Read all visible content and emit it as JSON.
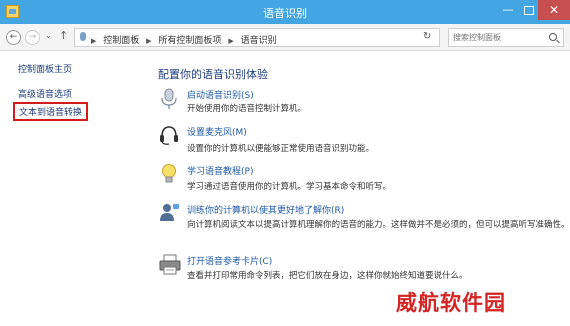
{
  "window": {
    "title": "语音识别",
    "minimize": "—",
    "close": "✕"
  },
  "nav": {
    "back": "←",
    "forward": "→",
    "recent": "⌄",
    "up": "↑",
    "refresh": "↻",
    "dropdown": "⌄",
    "breadcrumbs": [
      {
        "label": "控制面板"
      },
      {
        "label": "所有控制面板项"
      },
      {
        "label": "语音识别"
      }
    ],
    "search_placeholder": "搜索控制面板"
  },
  "sidebar": {
    "items": [
      {
        "label": "控制面板主页"
      },
      {
        "label": "高级语音选项"
      },
      {
        "label": "文本到语音转换",
        "selected": true
      }
    ]
  },
  "main": {
    "heading": "配置你的语音识别体验",
    "items": [
      {
        "link": "启动语音识别(S)",
        "desc": "开始使用你的语音控制计算机。",
        "icon": "microphone-icon"
      },
      {
        "link": "设置麦克风(M)",
        "desc": "设置你的计算机以便能够正常使用语音识别功能。",
        "icon": "headset-icon"
      },
      {
        "link": "学习语音教程(P)",
        "desc": "学习通过语音使用你的计算机。学习基本命令和听写。",
        "icon": "lightbulb-icon"
      },
      {
        "link": "训练你的计算机以使其更好地了解你(R)",
        "desc": "向计算机阅读文本以提高计算机理解你的语音的能力。这样做并不是必须的，但可以提高听写准确性。",
        "icon": "person-speaking-icon"
      },
      {
        "link": "打开语音参考卡片(C)",
        "desc": "查看并打印常用命令列表，把它们放在身边，这样你就始终知道要说什么。",
        "icon": "printer-icon"
      }
    ]
  },
  "watermark": "威航软件园"
}
